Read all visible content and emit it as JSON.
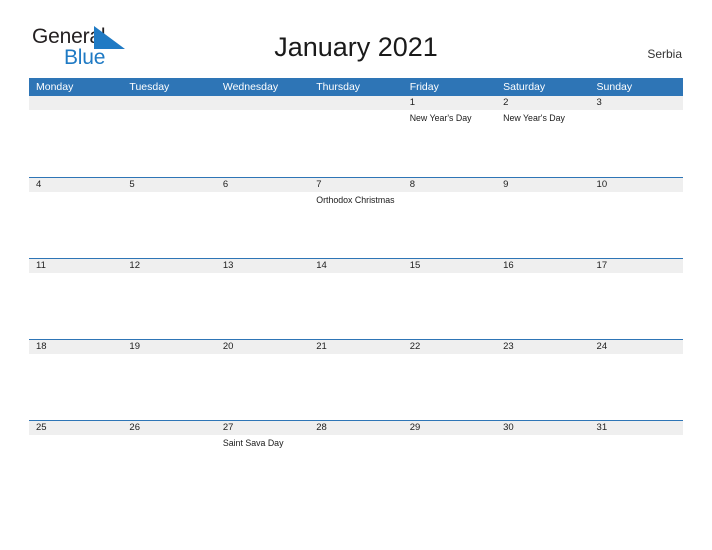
{
  "brand": {
    "name_part1": "General",
    "name_part2": "Blue",
    "flag_icon": "blue-triangle-flag-icon",
    "color_primary": "#1f7ac4",
    "color_text": "#231f20"
  },
  "header": {
    "title": "January 2021",
    "country": "Serbia",
    "header_bg": "#2e75b6",
    "band_bg": "#efefef"
  },
  "calendar": {
    "weekdays": [
      "Monday",
      "Tuesday",
      "Wednesday",
      "Thursday",
      "Friday",
      "Saturday",
      "Sunday"
    ],
    "weeks": [
      {
        "days": [
          {
            "date": "",
            "events": []
          },
          {
            "date": "",
            "events": []
          },
          {
            "date": "",
            "events": []
          },
          {
            "date": "",
            "events": []
          },
          {
            "date": "1",
            "events": [
              "New Year's Day"
            ]
          },
          {
            "date": "2",
            "events": [
              "New Year's Day"
            ]
          },
          {
            "date": "3",
            "events": []
          }
        ]
      },
      {
        "days": [
          {
            "date": "4",
            "events": []
          },
          {
            "date": "5",
            "events": []
          },
          {
            "date": "6",
            "events": []
          },
          {
            "date": "7",
            "events": [
              "Orthodox Christmas"
            ]
          },
          {
            "date": "8",
            "events": []
          },
          {
            "date": "9",
            "events": []
          },
          {
            "date": "10",
            "events": []
          }
        ]
      },
      {
        "days": [
          {
            "date": "11",
            "events": []
          },
          {
            "date": "12",
            "events": []
          },
          {
            "date": "13",
            "events": []
          },
          {
            "date": "14",
            "events": []
          },
          {
            "date": "15",
            "events": []
          },
          {
            "date": "16",
            "events": []
          },
          {
            "date": "17",
            "events": []
          }
        ]
      },
      {
        "days": [
          {
            "date": "18",
            "events": []
          },
          {
            "date": "19",
            "events": []
          },
          {
            "date": "20",
            "events": []
          },
          {
            "date": "21",
            "events": []
          },
          {
            "date": "22",
            "events": []
          },
          {
            "date": "23",
            "events": []
          },
          {
            "date": "24",
            "events": []
          }
        ]
      },
      {
        "days": [
          {
            "date": "25",
            "events": []
          },
          {
            "date": "26",
            "events": []
          },
          {
            "date": "27",
            "events": [
              "Saint Sava Day"
            ]
          },
          {
            "date": "28",
            "events": []
          },
          {
            "date": "29",
            "events": []
          },
          {
            "date": "30",
            "events": []
          },
          {
            "date": "31",
            "events": []
          }
        ]
      }
    ]
  }
}
